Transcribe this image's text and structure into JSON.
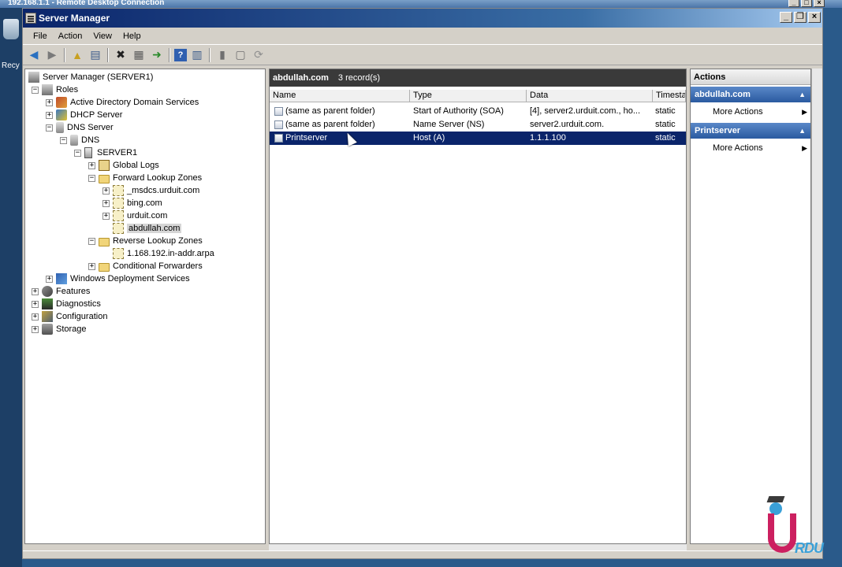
{
  "rdp": {
    "title": "192.168.1.1 - Remote Desktop Connection"
  },
  "desktop": {
    "recycle_label": "Recy"
  },
  "window": {
    "title": "Server Manager"
  },
  "menu": [
    "File",
    "Action",
    "View",
    "Help"
  ],
  "tree": {
    "root": "Server Manager (SERVER1)",
    "roles": "Roles",
    "adds": "Active Directory Domain Services",
    "dhcp": "DHCP Server",
    "dns_server": "DNS Server",
    "dns": "DNS",
    "server1": "SERVER1",
    "global_logs": "Global Logs",
    "forward_zones": "Forward Lookup Zones",
    "msdcs": "_msdcs.urduit.com",
    "bing": "bing.com",
    "urduit": "urduit.com",
    "abdullah": "abdullah.com",
    "reverse_zones": "Reverse Lookup Zones",
    "reverse_zone": "1.168.192.in-addr.arpa",
    "cond_forwarders": "Conditional Forwarders",
    "wds": "Windows Deployment Services",
    "features": "Features",
    "diagnostics": "Diagnostics",
    "configuration": "Configuration",
    "storage": "Storage"
  },
  "center": {
    "zone": "abdullah.com",
    "count": "3 record(s)",
    "columns": [
      "Name",
      "Type",
      "Data",
      "Timestamp"
    ],
    "rows": [
      {
        "name": "(same as parent folder)",
        "type": "Start of Authority (SOA)",
        "data": "[4], server2.urduit.com., ho...",
        "ts": "static"
      },
      {
        "name": "(same as parent folder)",
        "type": "Name Server (NS)",
        "data": "server2.urduit.com.",
        "ts": "static"
      },
      {
        "name": "Printserver",
        "type": "Host (A)",
        "data": "1.1.1.100",
        "ts": "static"
      }
    ]
  },
  "actions": {
    "title": "Actions",
    "group1": "abdullah.com",
    "group1_item": "More Actions",
    "group2": "Printserver",
    "group2_item": "More Actions"
  },
  "watermark": {
    "text": "RDU"
  }
}
